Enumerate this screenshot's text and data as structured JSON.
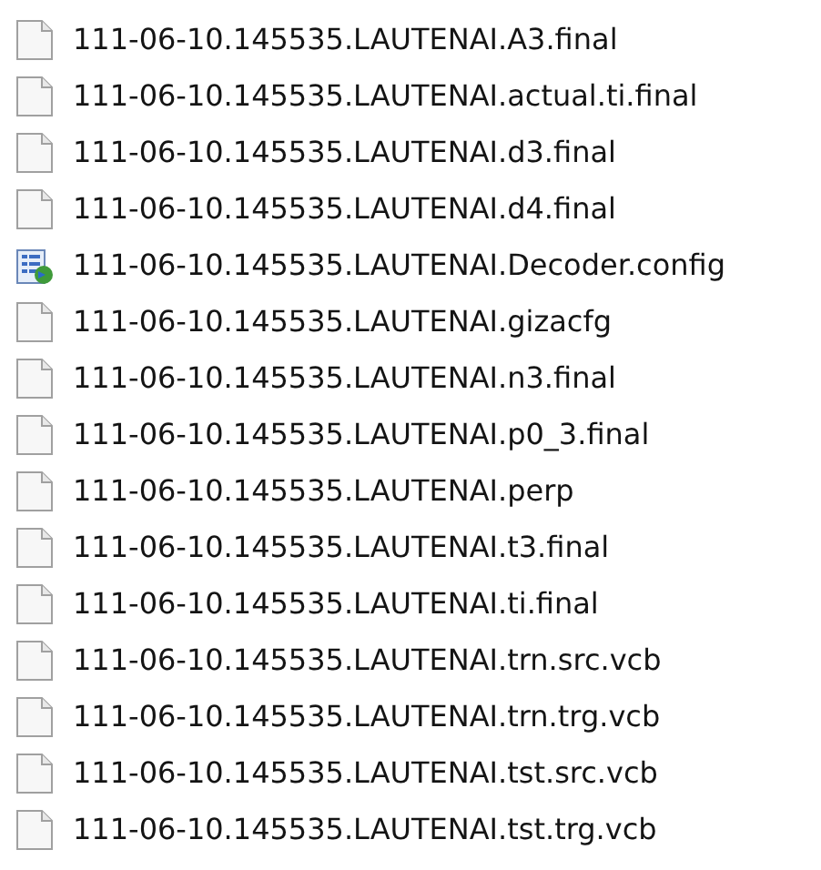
{
  "files": [
    {
      "name": "111-06-10.145535.LAUTENAI.A3.final",
      "kind": "file"
    },
    {
      "name": "111-06-10.145535.LAUTENAI.actual.ti.final",
      "kind": "file"
    },
    {
      "name": "111-06-10.145535.LAUTENAI.d3.final",
      "kind": "file"
    },
    {
      "name": "111-06-10.145535.LAUTENAI.d4.final",
      "kind": "file"
    },
    {
      "name": "111-06-10.145535.LAUTENAI.Decoder.config",
      "kind": "config"
    },
    {
      "name": "111-06-10.145535.LAUTENAI.gizacfg",
      "kind": "file"
    },
    {
      "name": "111-06-10.145535.LAUTENAI.n3.final",
      "kind": "file"
    },
    {
      "name": "111-06-10.145535.LAUTENAI.p0_3.final",
      "kind": "file"
    },
    {
      "name": "111-06-10.145535.LAUTENAI.perp",
      "kind": "file"
    },
    {
      "name": "111-06-10.145535.LAUTENAI.t3.final",
      "kind": "file"
    },
    {
      "name": "111-06-10.145535.LAUTENAI.ti.final",
      "kind": "file"
    },
    {
      "name": "111-06-10.145535.LAUTENAI.trn.src.vcb",
      "kind": "file"
    },
    {
      "name": "111-06-10.145535.LAUTENAI.trn.trg.vcb",
      "kind": "file"
    },
    {
      "name": "111-06-10.145535.LAUTENAI.tst.src.vcb",
      "kind": "file"
    },
    {
      "name": "111-06-10.145535.LAUTENAI.tst.trg.vcb",
      "kind": "file"
    }
  ]
}
